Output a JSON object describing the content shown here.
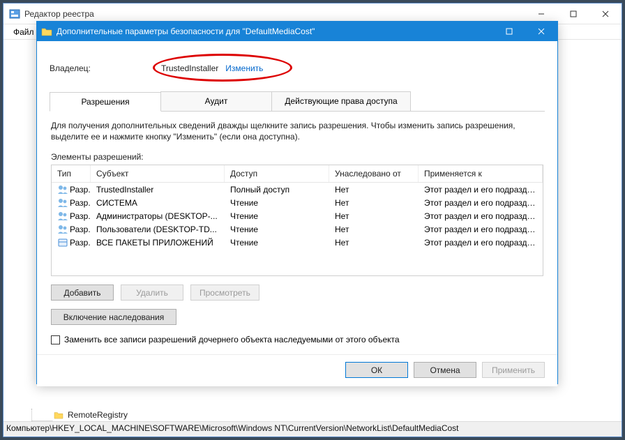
{
  "regedit": {
    "title": "Редактор реестра",
    "menu": {
      "file": "Файл"
    },
    "tree": {
      "item1": "RemoteRegistry"
    },
    "status": "Компьютер\\HKEY_LOCAL_MACHINE\\SOFTWARE\\Microsoft\\Windows NT\\CurrentVersion\\NetworkList\\DefaultMediaCost"
  },
  "dialog": {
    "title": "Дополнительные параметры безопасности для \"DefaultMediaCost\"",
    "owner_label": "Владелец:",
    "owner_value": "TrustedInstaller",
    "owner_change": "Изменить",
    "tabs": {
      "perm": "Разрешения",
      "audit": "Аудит",
      "eff": "Действующие права доступа"
    },
    "instr": "Для получения дополнительных сведений дважды щелкните запись разрешения. Чтобы изменить запись разрешения, выделите ее и нажмите кнопку \"Изменить\" (если она доступна).",
    "perm_label": "Элементы разрешений:",
    "cols": {
      "type": "Тип",
      "subject": "Субъект",
      "access": "Доступ",
      "inherit": "Унаследовано от",
      "applies": "Применяется к"
    },
    "rows": [
      {
        "icon": "users",
        "type": "Разр...",
        "subject": "TrustedInstaller",
        "access": "Полный доступ",
        "inherit": "Нет",
        "applies": "Этот раздел и его подразделы"
      },
      {
        "icon": "users",
        "type": "Разр...",
        "subject": "СИСТЕМА",
        "access": "Чтение",
        "inherit": "Нет",
        "applies": "Этот раздел и его подразделы"
      },
      {
        "icon": "users",
        "type": "Разр...",
        "subject": "Администраторы (DESKTOP-...",
        "access": "Чтение",
        "inherit": "Нет",
        "applies": "Этот раздел и его подразделы"
      },
      {
        "icon": "users",
        "type": "Разр...",
        "subject": "Пользователи (DESKTOP-TD...",
        "access": "Чтение",
        "inherit": "Нет",
        "applies": "Этот раздел и его подразделы"
      },
      {
        "icon": "pkg",
        "type": "Разр...",
        "subject": "ВСЕ ПАКЕТЫ ПРИЛОЖЕНИЙ",
        "access": "Чтение",
        "inherit": "Нет",
        "applies": "Этот раздел и его подразделы"
      }
    ],
    "btn_add": "Добавить",
    "btn_del": "Удалить",
    "btn_view": "Просмотреть",
    "btn_enable_inherit": "Включение наследования",
    "chk_replace": "Заменить все записи разрешений дочернего объекта наследуемыми от этого объекта",
    "btn_ok": "ОК",
    "btn_cancel": "Отмена",
    "btn_apply": "Применить"
  }
}
